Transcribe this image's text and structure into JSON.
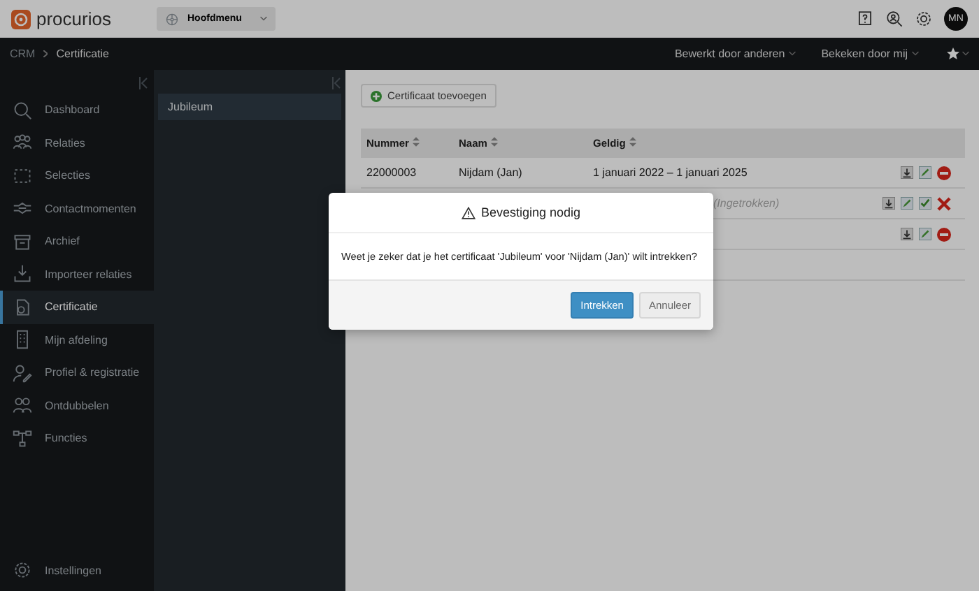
{
  "header": {
    "logo": "procurios",
    "menu_button": "Hoofdmenu",
    "avatar": "MN"
  },
  "breadcrumb": [
    "CRM",
    "Certificatie"
  ],
  "nav_filters": [
    "Bewerkt door anderen",
    "Bekeken door mij"
  ],
  "sidebar": {
    "items": [
      {
        "label": "Dashboard",
        "selected": false
      },
      {
        "label": "Relaties",
        "selected": false
      },
      {
        "label": "Selecties",
        "selected": false
      },
      {
        "label": "Contactmomenten",
        "selected": false
      },
      {
        "label": "Archief",
        "selected": false
      },
      {
        "label": "Importeer relaties",
        "selected": false
      },
      {
        "label": "Certificatie",
        "selected": true
      },
      {
        "label": "Mijn afdeling",
        "selected": false
      },
      {
        "label": "Profiel & registratie",
        "selected": false
      },
      {
        "label": "Ontdubbelen",
        "selected": false
      },
      {
        "label": "Functies",
        "selected": false
      }
    ],
    "footer": "Instellingen"
  },
  "subpanel": {
    "items": [
      {
        "label": "Jubileum",
        "selected": true
      }
    ]
  },
  "toolbar": {
    "add_button": "Certificaat toevoegen"
  },
  "table": {
    "columns": [
      "Nummer",
      "Naam",
      "Geldig"
    ],
    "rows": [
      {
        "number": "22000003",
        "name": "Nijdam (Jan)",
        "valid": "1 januari 2022 – 1 januari 2025",
        "revoked": false,
        "actions": [
          {
            "kind": "download"
          },
          {
            "kind": "edit"
          },
          {
            "kind": "revoke"
          }
        ]
      },
      {
        "valid": "(Ingetrokken)",
        "revoked": true,
        "actions": [
          {
            "kind": "download"
          },
          {
            "kind": "edit"
          },
          {
            "kind": "approve"
          },
          {
            "kind": "delete"
          }
        ]
      },
      {
        "revoked": false,
        "actions": [
          {
            "kind": "download"
          },
          {
            "kind": "edit"
          },
          {
            "kind": "revoke"
          }
        ]
      }
    ]
  },
  "dialog": {
    "title": "Bevestiging nodig",
    "message": "Weet je zeker dat je het certificaat 'Jubileum' voor 'Nijdam (Jan)' wilt intrekken?",
    "buttons": [
      {
        "label": "Intrekken",
        "kind": "primary"
      },
      {
        "label": "Annuleer",
        "kind": "secondary"
      }
    ]
  }
}
